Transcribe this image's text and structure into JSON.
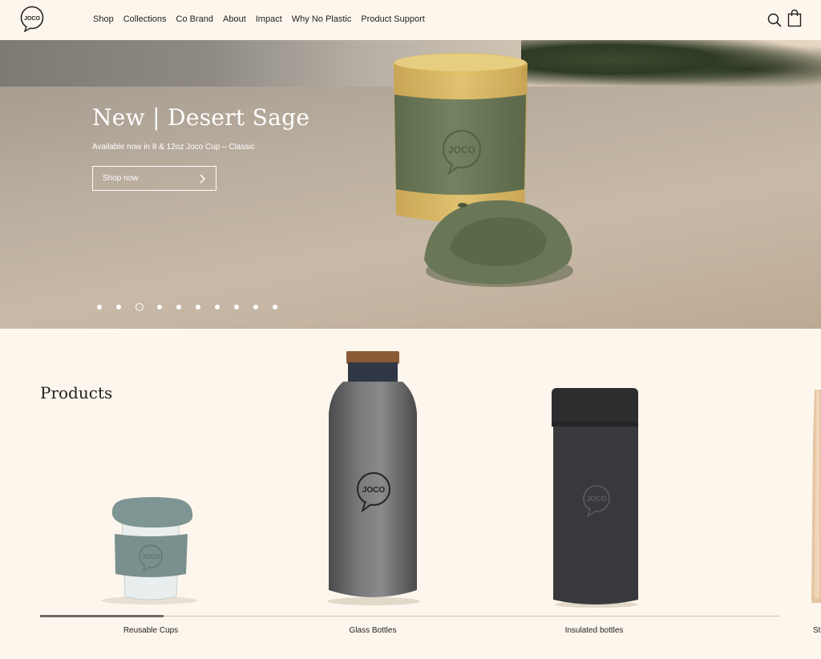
{
  "brand": {
    "logo_text": "JOCO"
  },
  "nav": {
    "items": [
      "Shop",
      "Collections",
      "Co Brand",
      "About",
      "Impact",
      "Why No Plastic",
      "Product Support"
    ]
  },
  "header_icons": {
    "search": "search-icon",
    "bag": "shopping-bag-icon"
  },
  "hero": {
    "title": "New | Desert Sage",
    "subtitle": "Available now in 8 & 12oz Joco Cup – Classic",
    "button_label": "Shop now",
    "button_icon": "chevron-right-icon",
    "slide_count": 10,
    "active_slide": 3,
    "cup_logo": "JOCO"
  },
  "products": {
    "heading": "Products",
    "categories": [
      {
        "label": "Reusable Cups",
        "logo": "JOCO"
      },
      {
        "label": "Glass Bottles",
        "logo": "JOCO"
      },
      {
        "label": "Insulated bottles",
        "logo": "JOCO"
      },
      {
        "label": "Stra"
      }
    ]
  },
  "colors": {
    "background": "#fdf6ec",
    "sage_green": "#6f7c5c",
    "text_dark": "#222222"
  }
}
